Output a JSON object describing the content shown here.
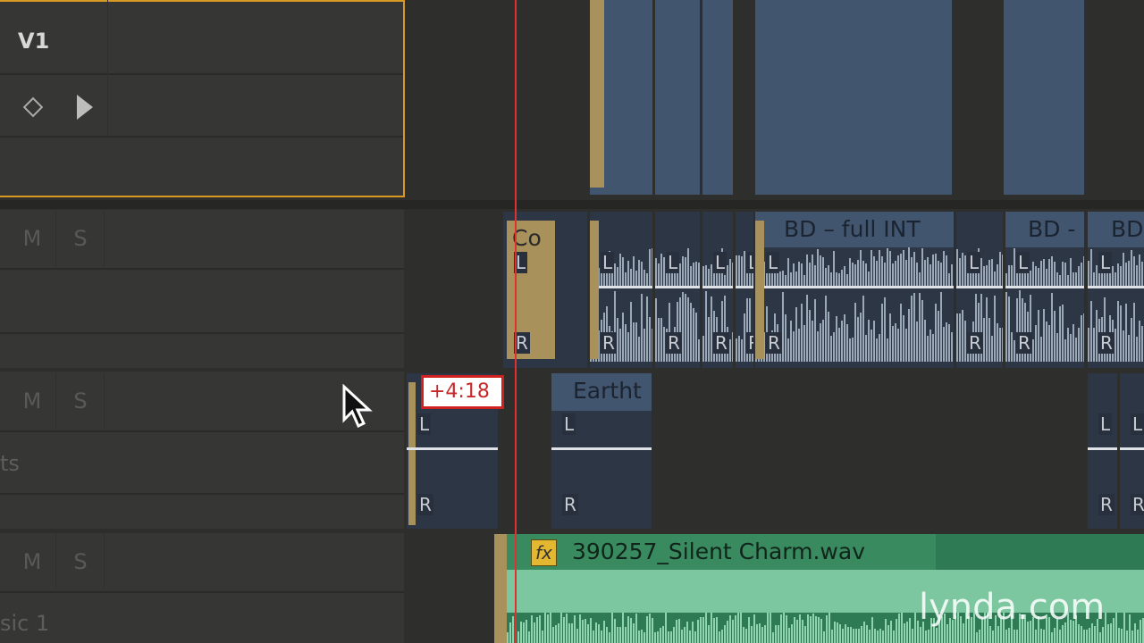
{
  "video_track": {
    "name": "V1",
    "keyframe_icon": "diamond-icon",
    "play_icon": "play-icon"
  },
  "audio_tracks": [
    {
      "mute": "M",
      "solo": "S",
      "name": ""
    },
    {
      "mute": "M",
      "solo": "S",
      "name": "ts"
    },
    {
      "mute": "M",
      "solo": "S",
      "name": "sic 1"
    }
  ],
  "clips": {
    "a1": [
      "Co",
      "BD – full INT",
      "BD -",
      "BD"
    ],
    "a2": {
      "offset_badge": "+4:18",
      "clip": "Eartht"
    },
    "a3": {
      "fx": "fx",
      "clip": "390257_Silent Charm.wav"
    },
    "channel_left": "L",
    "channel_right": "R"
  },
  "colors": {
    "playhead": "#e03030",
    "selection": "#e0a020",
    "audio_clip": "#3f5673",
    "music_clip": "#6fbf95",
    "nested": "#a8915a"
  },
  "watermark": "lynda.com"
}
